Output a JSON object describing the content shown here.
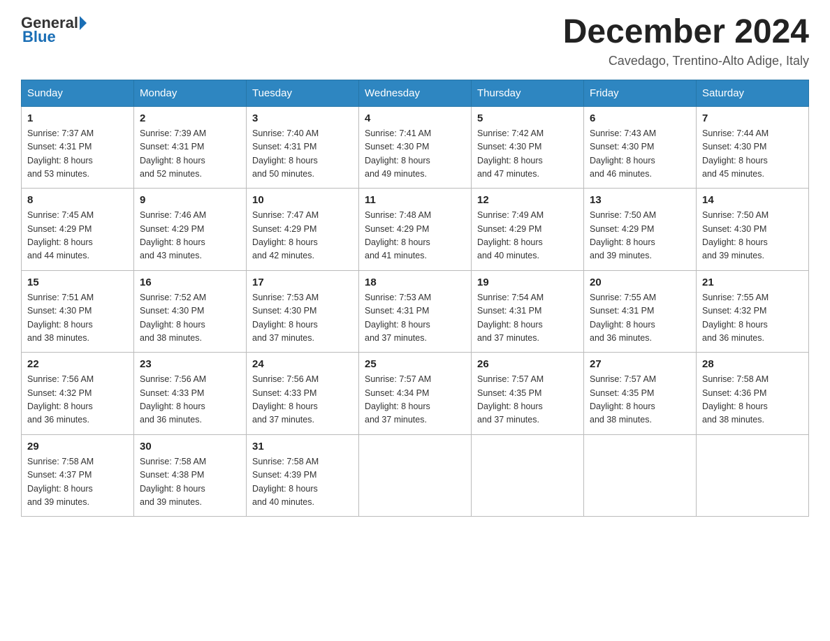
{
  "header": {
    "logo": {
      "general": "General",
      "blue": "Blue"
    },
    "title": "December 2024",
    "location": "Cavedago, Trentino-Alto Adige, Italy"
  },
  "days_of_week": [
    "Sunday",
    "Monday",
    "Tuesday",
    "Wednesday",
    "Thursday",
    "Friday",
    "Saturday"
  ],
  "weeks": [
    [
      {
        "day": 1,
        "sunrise": "7:37 AM",
        "sunset": "4:31 PM",
        "daylight": "8 hours and 53 minutes."
      },
      {
        "day": 2,
        "sunrise": "7:39 AM",
        "sunset": "4:31 PM",
        "daylight": "8 hours and 52 minutes."
      },
      {
        "day": 3,
        "sunrise": "7:40 AM",
        "sunset": "4:31 PM",
        "daylight": "8 hours and 50 minutes."
      },
      {
        "day": 4,
        "sunrise": "7:41 AM",
        "sunset": "4:30 PM",
        "daylight": "8 hours and 49 minutes."
      },
      {
        "day": 5,
        "sunrise": "7:42 AM",
        "sunset": "4:30 PM",
        "daylight": "8 hours and 47 minutes."
      },
      {
        "day": 6,
        "sunrise": "7:43 AM",
        "sunset": "4:30 PM",
        "daylight": "8 hours and 46 minutes."
      },
      {
        "day": 7,
        "sunrise": "7:44 AM",
        "sunset": "4:30 PM",
        "daylight": "8 hours and 45 minutes."
      }
    ],
    [
      {
        "day": 8,
        "sunrise": "7:45 AM",
        "sunset": "4:29 PM",
        "daylight": "8 hours and 44 minutes."
      },
      {
        "day": 9,
        "sunrise": "7:46 AM",
        "sunset": "4:29 PM",
        "daylight": "8 hours and 43 minutes."
      },
      {
        "day": 10,
        "sunrise": "7:47 AM",
        "sunset": "4:29 PM",
        "daylight": "8 hours and 42 minutes."
      },
      {
        "day": 11,
        "sunrise": "7:48 AM",
        "sunset": "4:29 PM",
        "daylight": "8 hours and 41 minutes."
      },
      {
        "day": 12,
        "sunrise": "7:49 AM",
        "sunset": "4:29 PM",
        "daylight": "8 hours and 40 minutes."
      },
      {
        "day": 13,
        "sunrise": "7:50 AM",
        "sunset": "4:29 PM",
        "daylight": "8 hours and 39 minutes."
      },
      {
        "day": 14,
        "sunrise": "7:50 AM",
        "sunset": "4:30 PM",
        "daylight": "8 hours and 39 minutes."
      }
    ],
    [
      {
        "day": 15,
        "sunrise": "7:51 AM",
        "sunset": "4:30 PM",
        "daylight": "8 hours and 38 minutes."
      },
      {
        "day": 16,
        "sunrise": "7:52 AM",
        "sunset": "4:30 PM",
        "daylight": "8 hours and 38 minutes."
      },
      {
        "day": 17,
        "sunrise": "7:53 AM",
        "sunset": "4:30 PM",
        "daylight": "8 hours and 37 minutes."
      },
      {
        "day": 18,
        "sunrise": "7:53 AM",
        "sunset": "4:31 PM",
        "daylight": "8 hours and 37 minutes."
      },
      {
        "day": 19,
        "sunrise": "7:54 AM",
        "sunset": "4:31 PM",
        "daylight": "8 hours and 37 minutes."
      },
      {
        "day": 20,
        "sunrise": "7:55 AM",
        "sunset": "4:31 PM",
        "daylight": "8 hours and 36 minutes."
      },
      {
        "day": 21,
        "sunrise": "7:55 AM",
        "sunset": "4:32 PM",
        "daylight": "8 hours and 36 minutes."
      }
    ],
    [
      {
        "day": 22,
        "sunrise": "7:56 AM",
        "sunset": "4:32 PM",
        "daylight": "8 hours and 36 minutes."
      },
      {
        "day": 23,
        "sunrise": "7:56 AM",
        "sunset": "4:33 PM",
        "daylight": "8 hours and 36 minutes."
      },
      {
        "day": 24,
        "sunrise": "7:56 AM",
        "sunset": "4:33 PM",
        "daylight": "8 hours and 37 minutes."
      },
      {
        "day": 25,
        "sunrise": "7:57 AM",
        "sunset": "4:34 PM",
        "daylight": "8 hours and 37 minutes."
      },
      {
        "day": 26,
        "sunrise": "7:57 AM",
        "sunset": "4:35 PM",
        "daylight": "8 hours and 37 minutes."
      },
      {
        "day": 27,
        "sunrise": "7:57 AM",
        "sunset": "4:35 PM",
        "daylight": "8 hours and 38 minutes."
      },
      {
        "day": 28,
        "sunrise": "7:58 AM",
        "sunset": "4:36 PM",
        "daylight": "8 hours and 38 minutes."
      }
    ],
    [
      {
        "day": 29,
        "sunrise": "7:58 AM",
        "sunset": "4:37 PM",
        "daylight": "8 hours and 39 minutes."
      },
      {
        "day": 30,
        "sunrise": "7:58 AM",
        "sunset": "4:38 PM",
        "daylight": "8 hours and 39 minutes."
      },
      {
        "day": 31,
        "sunrise": "7:58 AM",
        "sunset": "4:39 PM",
        "daylight": "8 hours and 40 minutes."
      },
      null,
      null,
      null,
      null
    ]
  ],
  "labels": {
    "sunrise": "Sunrise:",
    "sunset": "Sunset:",
    "daylight": "Daylight:"
  },
  "colors": {
    "header_bg": "#2e86c1",
    "header_text": "#ffffff",
    "border": "#bbbbbb"
  }
}
